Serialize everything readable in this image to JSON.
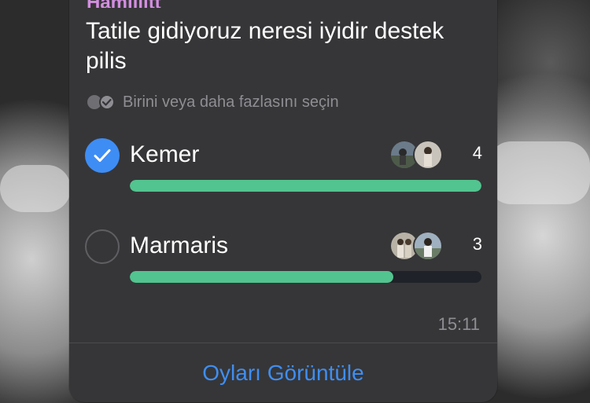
{
  "message": {
    "sender": "Hamiiiitt",
    "question": "Tatile gidiyoruz neresi iyidir destek pilis",
    "subtitle": "Birini veya daha fazlasını seçin",
    "time": "15:11"
  },
  "poll": {
    "options": [
      {
        "label": "Kemer",
        "votes": "4",
        "checked": true,
        "fraction": 1.0
      },
      {
        "label": "Marmaris",
        "votes": "3",
        "checked": false,
        "fraction": 0.75
      }
    ]
  },
  "footer": {
    "view_votes_label": "Oyları Görüntüle"
  },
  "colors": {
    "bar": "#52c48f",
    "accent": "#3e8df5",
    "link": "#3f8ef2",
    "sender": "#d38ee0"
  }
}
